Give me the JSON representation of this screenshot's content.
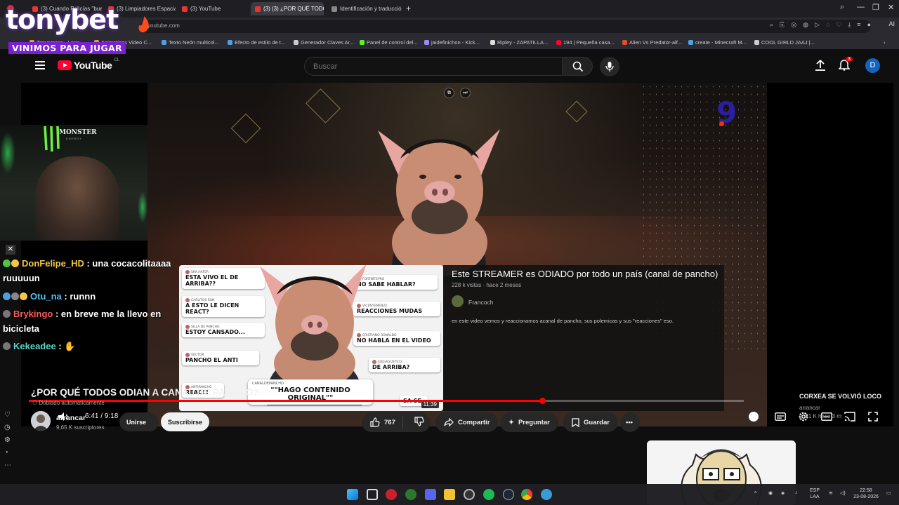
{
  "browser": {
    "tabs": [
      {
        "label": "(3) Cuando Policías \"buen"
      },
      {
        "label": "(3) Limpiadores Espaciale"
      },
      {
        "label": "(3) YouTube"
      },
      {
        "label": "(3) (3) ¿POR QUÉ TODOS"
      },
      {
        "label": "Identificación y traducción"
      }
    ],
    "new_tab": "+",
    "url": "youtube.com",
    "ai_label": "AI",
    "bookmarks": [
      {
        "label": "Tonyscraps - Logo",
        "color": "#d9a03a"
      },
      {
        "label": "Animations Video C...",
        "color": "#d9a03a"
      },
      {
        "label": "Texto Neón multicol...",
        "color": "#4aa3e0"
      },
      {
        "label": "Efecto de estilo de t...",
        "color": "#4aa3e0"
      },
      {
        "label": "Generador Claves Ar...",
        "color": "#cccccc"
      },
      {
        "label": "Panel de control del...",
        "color": "#53fc18"
      },
      {
        "label": "jaidefinichon - Kick...",
        "color": "#9a8cff"
      },
      {
        "label": "Ripley - ZAPATILLA...",
        "color": "#dddddd"
      },
      {
        "label": "194 | Pequeña casa...",
        "color": "#ff0033"
      },
      {
        "label": "Alien Vs Predator-alf...",
        "color": "#e34d2b"
      },
      {
        "label": "create - Minecraft M...",
        "color": "#4aa3e0"
      },
      {
        "label": "COOL GIRLD JAAJ |...",
        "color": "#cccccc"
      }
    ]
  },
  "stream_overlay": {
    "brand_name": "tonybet",
    "brand_tagline": "VINIMOS PARA JUGAR",
    "sponsor_name": "MONSTER",
    "sponsor_sub": "ENERGY",
    "chat": [
      {
        "user": "DonFelipe_HD",
        "user_color": "#f6c744",
        "text": ": una cocacolitaaaa ruuuuun"
      },
      {
        "user": "Otu_na",
        "user_color": "#4fc3f7",
        "text": ": runnn"
      },
      {
        "user": "Brykingo",
        "user_color": "#ff5a5a",
        "text": ": en breve me la llevo en bicicleta"
      },
      {
        "user": "Kekeadee",
        "user_color": "#5fd3c4",
        "text": ":"
      }
    ]
  },
  "youtube": {
    "logo_text": "YouTube",
    "country_code": "CL",
    "search_placeholder": "Buscar",
    "notifications_count": "3",
    "avatar_letter": "D",
    "player": {
      "current_time": "6:41",
      "duration": "9:18",
      "progress": 0.719,
      "channel_watermark": "9"
    },
    "end_card": {
      "title": "Este STREAMER es ODIADO por todo un país (canal de pancho)",
      "meta": "228 k vistas · hace 2 meses",
      "channel": "Francoch",
      "description": "en este video vemos y reaccionamos acanal de pancho, sus polemicas y sus \"reacciones\" eso.",
      "thumb_duration": "11:39",
      "thumb_comments": [
        {
          "user": "SRA.HATER",
          "text": "ESTA VIVO EL DE ARRIBA??"
        },
        {
          "user": "CARLITOS RUN",
          "text": "A ESTO LE DICEN REACT?"
        },
        {
          "user": "SILLA DE PANCHO",
          "text": "ESTOY CANSADO..."
        },
        {
          "user": "VECTOR",
          "text": "PANCHO EL ANTI"
        },
        {
          "user": "ANTIPANCHO",
          "text": "REACCI"
        },
        {
          "user": "FORTNITEPRO",
          "text": "NO SABE HABLAR?"
        },
        {
          "user": "VICENTEMEN22",
          "text": "REACCIONES MUDAS"
        },
        {
          "user": "CRISTIANO RONALDO",
          "text": "NO HABLA EN EL VIDEO"
        },
        {
          "user": "JUEGAGUSTE72",
          "text": "DE ARRIBA?"
        },
        {
          "user": "",
          "text": "SA SE"
        }
      ],
      "bubble_user": "CANALDEPANCHO",
      "bubble_text": "\"\"HAGO CONTENIDO ORIGINAL\"\""
    },
    "video": {
      "title": "¿POR QUÉ TODOS ODIAN A CANAL DE PANCHO?",
      "dubbed_label": "Doblado automáticamente",
      "channel": "arrancar",
      "subscribers": "9,65 K suscriptores",
      "join_label": "Unirse",
      "subscribe_label": "Suscribirse",
      "likes": "767",
      "share_label": "Compartir",
      "ask_label": "Preguntar",
      "save_label": "Guardar"
    },
    "recommended": {
      "title": "CORXEA SE VOLVIÓ LOCO",
      "channel": "arrancar",
      "meta": "▷ 21 K  hace 3 m"
    }
  },
  "taskbar": {
    "lang": "ESP",
    "lang_sub": "LAA",
    "time": "22:58",
    "date": "23-08-2026"
  },
  "colors": {
    "accent_red": "#ff0000",
    "brand_purple": "#7a1fd1",
    "yt_bg": "#0f0f0f"
  }
}
